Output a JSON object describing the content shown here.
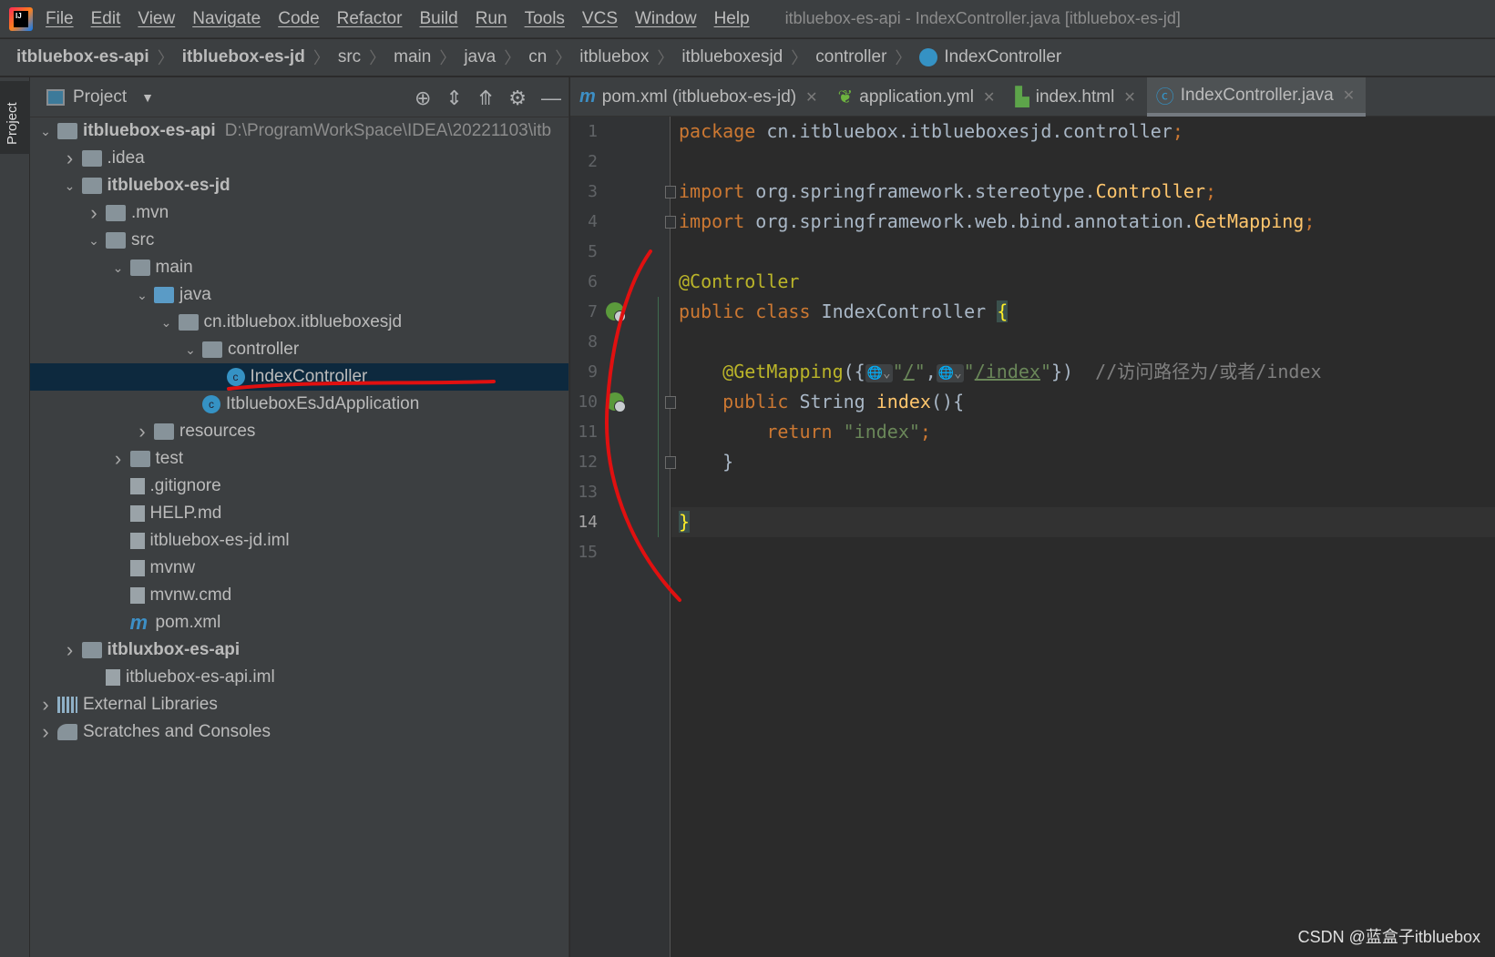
{
  "window": {
    "title": "itbluebox-es-api - IndexController.java [itbluebox-es-jd]",
    "logo": "IJ"
  },
  "menu": [
    "File",
    "Edit",
    "View",
    "Navigate",
    "Code",
    "Refactor",
    "Build",
    "Run",
    "Tools",
    "VCS",
    "Window",
    "Help"
  ],
  "breadcrumb": [
    {
      "label": "itbluebox-es-api",
      "bold": true
    },
    {
      "label": "itbluebox-es-jd",
      "bold": true
    },
    {
      "label": "src"
    },
    {
      "label": "main"
    },
    {
      "label": "java"
    },
    {
      "label": "cn"
    },
    {
      "label": "itbluebox"
    },
    {
      "label": "itblueboxesjd"
    },
    {
      "label": "controller"
    },
    {
      "label": "IndexController",
      "icon": "class-icon"
    }
  ],
  "stripe": {
    "project_label": "Project"
  },
  "project": {
    "title": "Project",
    "tree": [
      {
        "level": 0,
        "arrow": "down",
        "icon": "module",
        "label": "itbluebox-es-api",
        "bold": true,
        "path": "D:\\ProgramWorkSpace\\IDEA\\20221103\\itb"
      },
      {
        "level": 1,
        "arrow": "right",
        "icon": "folder",
        "label": ".idea"
      },
      {
        "level": 1,
        "arrow": "down",
        "icon": "module",
        "label": "itbluebox-es-jd",
        "bold": true
      },
      {
        "level": 2,
        "arrow": "right",
        "icon": "folder",
        "label": ".mvn"
      },
      {
        "level": 2,
        "arrow": "down",
        "icon": "folder",
        "label": "src"
      },
      {
        "level": 3,
        "arrow": "down",
        "icon": "folder",
        "label": "main"
      },
      {
        "level": 4,
        "arrow": "down",
        "icon": "folder-blue",
        "label": "java"
      },
      {
        "level": 5,
        "arrow": "down",
        "icon": "package",
        "label": "cn.itbluebox.itblueboxesjd"
      },
      {
        "level": 6,
        "arrow": "down",
        "icon": "package",
        "label": "controller"
      },
      {
        "level": 7,
        "arrow": "",
        "icon": "class",
        "label": "IndexController",
        "selected": true
      },
      {
        "level": 6,
        "arrow": "",
        "icon": "spring-class",
        "label": "ItblueboxEsJdApplication"
      },
      {
        "level": 4,
        "arrow": "right",
        "icon": "folder-res",
        "label": "resources"
      },
      {
        "level": 3,
        "arrow": "right",
        "icon": "folder",
        "label": "test"
      },
      {
        "level": 3,
        "arrow": "",
        "icon": "file",
        "label": ".gitignore"
      },
      {
        "level": 3,
        "arrow": "",
        "icon": "markdown",
        "label": "HELP.md"
      },
      {
        "level": 3,
        "arrow": "",
        "icon": "file",
        "label": "itbluebox-es-jd.iml"
      },
      {
        "level": 3,
        "arrow": "",
        "icon": "script",
        "label": "mvnw"
      },
      {
        "level": 3,
        "arrow": "",
        "icon": "file",
        "label": "mvnw.cmd"
      },
      {
        "level": 3,
        "arrow": "",
        "icon": "maven",
        "label": "pom.xml"
      },
      {
        "level": 1,
        "arrow": "right",
        "icon": "module",
        "label": "itbluxbox-es-api",
        "bold": true
      },
      {
        "level": 2,
        "arrow": "",
        "icon": "file",
        "label": "itbluebox-es-api.iml"
      },
      {
        "level": 0,
        "arrow": "right",
        "icon": "libraries",
        "label": "External Libraries"
      },
      {
        "level": 0,
        "arrow": "right",
        "icon": "scratches",
        "label": "Scratches and Consoles"
      }
    ]
  },
  "tabs": [
    {
      "label": "pom.xml (itbluebox-es-jd)",
      "icon": "maven-icon"
    },
    {
      "label": "application.yml",
      "icon": "spring-yml-icon"
    },
    {
      "label": "index.html",
      "icon": "html-icon"
    },
    {
      "label": "IndexController.java",
      "icon": "class-icon",
      "active": true
    }
  ],
  "code": {
    "current_line": 14,
    "lines": [
      [
        [
          "kw",
          "package "
        ],
        [
          "",
          "cn.itbluebox.itblueboxesjd.controller"
        ],
        [
          "kw",
          ";"
        ]
      ],
      [],
      [
        [
          "kw",
          "import "
        ],
        [
          "",
          "org.springframework.stereotype."
        ],
        [
          "fn",
          "Controller"
        ],
        [
          "kw",
          ";"
        ]
      ],
      [
        [
          "kw",
          "import "
        ],
        [
          "",
          "org.springframework.web.bind.annotation."
        ],
        [
          "fn",
          "GetMapping"
        ],
        [
          "kw",
          ";"
        ]
      ],
      [],
      [
        [
          "ann",
          "@Controller"
        ]
      ],
      [
        [
          "kw",
          "public class "
        ],
        [
          "",
          "IndexController "
        ],
        [
          "brc",
          "{"
        ]
      ],
      [],
      [
        [
          "",
          "    "
        ],
        [
          "ann",
          "@GetMapping"
        ],
        [
          "",
          "({"
        ],
        [
          "chip",
          "🌐⌄"
        ],
        [
          "str",
          "\""
        ],
        [
          "url",
          "/"
        ],
        [
          "str",
          "\""
        ],
        [
          "",
          ","
        ],
        [
          "chip",
          "🌐⌄"
        ],
        [
          "str",
          "\""
        ],
        [
          "url",
          "/index"
        ],
        [
          "str",
          "\""
        ],
        [
          "",
          "})  "
        ],
        [
          "cmt",
          "//访问路径为/或者/index"
        ]
      ],
      [
        [
          "",
          "    "
        ],
        [
          "kw",
          "public "
        ],
        [
          "",
          "String "
        ],
        [
          "fn",
          "index"
        ],
        [
          "",
          "(){"
        ]
      ],
      [
        [
          "",
          "        "
        ],
        [
          "kw",
          "return "
        ],
        [
          "str",
          "\"index\""
        ],
        [
          "kw",
          ";"
        ]
      ],
      [
        [
          "",
          "    }"
        ]
      ],
      [],
      [
        [
          "brc",
          "}"
        ]
      ],
      []
    ]
  },
  "watermark": "CSDN @蓝盒子itbluebox"
}
